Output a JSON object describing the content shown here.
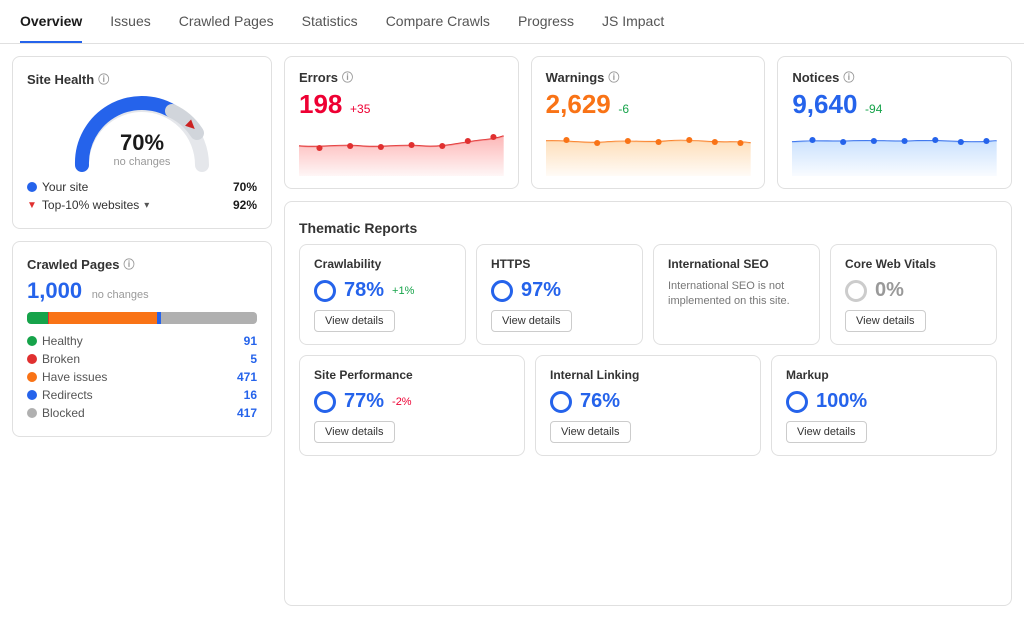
{
  "nav": {
    "items": [
      {
        "label": "Overview",
        "active": true
      },
      {
        "label": "Issues",
        "active": false
      },
      {
        "label": "Crawled Pages",
        "active": false
      },
      {
        "label": "Statistics",
        "active": false
      },
      {
        "label": "Compare Crawls",
        "active": false
      },
      {
        "label": "Progress",
        "active": false
      },
      {
        "label": "JS Impact",
        "active": false
      }
    ]
  },
  "siteHealth": {
    "title": "Site Health",
    "percent": "70%",
    "subLabel": "no changes",
    "legend": [
      {
        "color": "#2563eb",
        "type": "dot",
        "label": "Your site",
        "value": "70%"
      },
      {
        "color": "#e03030",
        "type": "triangle",
        "label": "Top-10% websites",
        "value": "92%"
      }
    ]
  },
  "crawledPages": {
    "title": "Crawled Pages",
    "count": "1,000",
    "noChanges": "no changes",
    "stats": [
      {
        "color": "#16a34a",
        "label": "Healthy",
        "value": "91"
      },
      {
        "color": "#e03030",
        "label": "Broken",
        "value": "5"
      },
      {
        "color": "#f97316",
        "label": "Have issues",
        "value": "471"
      },
      {
        "color": "#2563eb",
        "label": "Redirects",
        "value": "16"
      },
      {
        "color": "#b0b0b0",
        "label": "Blocked",
        "value": "417"
      }
    ],
    "progressSegments": [
      {
        "color": "#16a34a",
        "pct": 9.1
      },
      {
        "color": "#e03030",
        "pct": 0.5
      },
      {
        "color": "#f97316",
        "pct": 47.1
      },
      {
        "color": "#2563eb",
        "pct": 1.6
      },
      {
        "color": "#b0b0b0",
        "pct": 41.7
      }
    ]
  },
  "metrics": [
    {
      "label": "Errors",
      "value": "198",
      "change": "+35",
      "changeType": "pos",
      "color": "error-color",
      "chartColor": "#fca5a5",
      "chartLineColor": "#e03030"
    },
    {
      "label": "Warnings",
      "value": "2,629",
      "change": "-6",
      "changeType": "neg",
      "color": "warning-color",
      "chartColor": "#fed7aa",
      "chartLineColor": "#f97316"
    },
    {
      "label": "Notices",
      "value": "9,640",
      "change": "-94",
      "changeType": "neg",
      "color": "notice-color",
      "chartColor": "#bfdbfe",
      "chartLineColor": "#2563eb"
    }
  ],
  "thematicReports": {
    "title": "Thematic Reports",
    "topRow": [
      {
        "name": "Crawlability",
        "score": "78%",
        "change": "+1%",
        "changeType": "pos",
        "hasIcon": true,
        "iconColor": "blue",
        "hasDesc": false
      },
      {
        "name": "HTTPS",
        "score": "97%",
        "change": null,
        "changeType": null,
        "hasIcon": true,
        "iconColor": "blue",
        "hasDesc": false
      },
      {
        "name": "International SEO",
        "score": null,
        "change": null,
        "changeType": null,
        "hasIcon": false,
        "iconColor": null,
        "hasDesc": true,
        "desc": "International SEO is not implemented on this site."
      },
      {
        "name": "Core Web Vitals",
        "score": "0%",
        "change": null,
        "changeType": null,
        "hasIcon": true,
        "iconColor": "gray",
        "hasDesc": false
      }
    ],
    "bottomRow": [
      {
        "name": "Site Performance",
        "score": "77%",
        "change": "-2%",
        "changeType": "neg",
        "hasIcon": true,
        "iconColor": "blue"
      },
      {
        "name": "Internal Linking",
        "score": "76%",
        "change": null,
        "changeType": null,
        "hasIcon": true,
        "iconColor": "blue"
      },
      {
        "name": "Markup",
        "score": "100%",
        "change": null,
        "changeType": null,
        "hasIcon": true,
        "iconColor": "blue"
      }
    ],
    "viewDetailsLabel": "View details"
  }
}
